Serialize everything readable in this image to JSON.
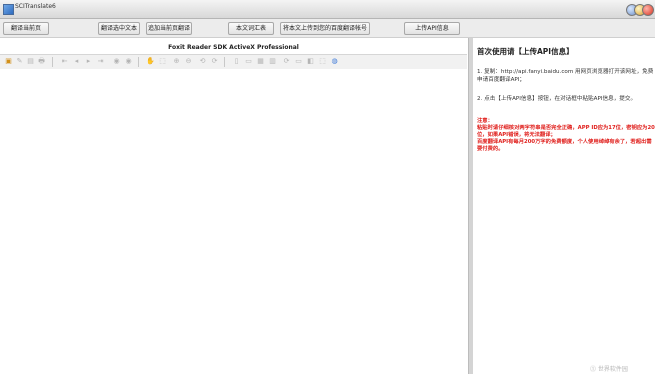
{
  "window": {
    "title": "SCITranslate6"
  },
  "toolbar": {
    "buttons": [
      {
        "label": "翻译当前页"
      },
      {
        "label": "翻译选中文本"
      },
      {
        "label": "追加当前页翻译"
      },
      {
        "label": "本文词汇表"
      },
      {
        "label": "将本文上传到您的百度翻译帐号"
      },
      {
        "label": "上传API信息"
      }
    ]
  },
  "viewer": {
    "title": "Foxit Reader SDK ActiveX Professional",
    "tools": [
      "▣",
      "✎",
      "▤",
      "🖶",
      "⇤",
      "◂",
      "▸",
      "⇥",
      "◉",
      "◉",
      "✋",
      "⬚",
      "⊕",
      "⊖",
      "⟲",
      "⟳",
      "▯",
      "▭",
      "▦",
      "▥",
      "⟳",
      "▭",
      "◧",
      "⬚",
      "◍"
    ]
  },
  "panel": {
    "heading": "首次使用请【上传API信息】",
    "step1": "1. 复制：http://api.fanyi.baidu.com 用网页浏览器打开该网址，免费申请百度翻译API；",
    "step2": "2. 点击【上传API信息】按钮，在对话框中粘贴API信息，提交。",
    "notice": [
      "注意：",
      "粘贴时请仔细核对两字符串是否完全正确，APP ID应为17位，密钥应为20位，如果API错误，将无法翻译；",
      "百度翻译API有每月200万字的免费额度，个人使用绰绰有余了，若超出需要付费的。"
    ]
  },
  "watermark": {
    "text": "⓵ 世界软件园"
  }
}
